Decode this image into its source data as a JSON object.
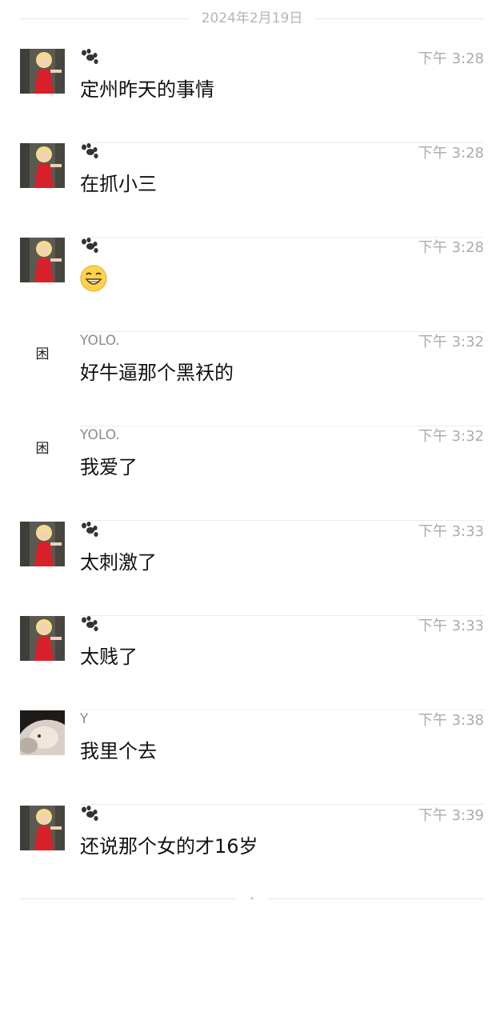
{
  "date_header": "2024年2月19日",
  "messages": [
    {
      "sender": "",
      "sender_icon": "paw-icon",
      "avatar": "blonde-red-dress-avatar",
      "time": "下午 3:28",
      "text": "定州昨天的事情"
    },
    {
      "sender": "",
      "sender_icon": "paw-icon",
      "avatar": "blonde-red-dress-avatar",
      "time": "下午 3:28",
      "text": "在抓小三"
    },
    {
      "sender": "",
      "sender_icon": "paw-icon",
      "avatar": "blonde-red-dress-avatar",
      "time": "下午 3:28",
      "text": "",
      "emoji": "grinning-face-emoji"
    },
    {
      "sender": "YOLO.",
      "avatar": "glyph-avatar",
      "avatar_glyph": "困",
      "time": "下午 3:32",
      "text": "好牛逼那个黑袄的"
    },
    {
      "sender": "YOLO.",
      "avatar": "glyph-avatar",
      "avatar_glyph": "困",
      "time": "下午 3:32",
      "text": "我爱了"
    },
    {
      "sender": "",
      "sender_icon": "paw-icon",
      "avatar": "blonde-red-dress-avatar",
      "time": "下午 3:33",
      "text": "太刺激了"
    },
    {
      "sender": "",
      "sender_icon": "paw-icon",
      "avatar": "blonde-red-dress-avatar",
      "time": "下午 3:33",
      "text": "太贱了"
    },
    {
      "sender": "Y",
      "avatar": "dark-hair-photo-avatar",
      "time": "下午 3:38",
      "text": "我里个去"
    },
    {
      "sender": "",
      "sender_icon": "paw-icon",
      "avatar": "blonde-red-dress-avatar",
      "time": "下午 3:39",
      "text": "还说那个女的才16岁"
    }
  ],
  "colors": {
    "background": "#ffffff",
    "message_text": "#111111",
    "meta_text": "#ababab",
    "divider": "#ececec"
  }
}
